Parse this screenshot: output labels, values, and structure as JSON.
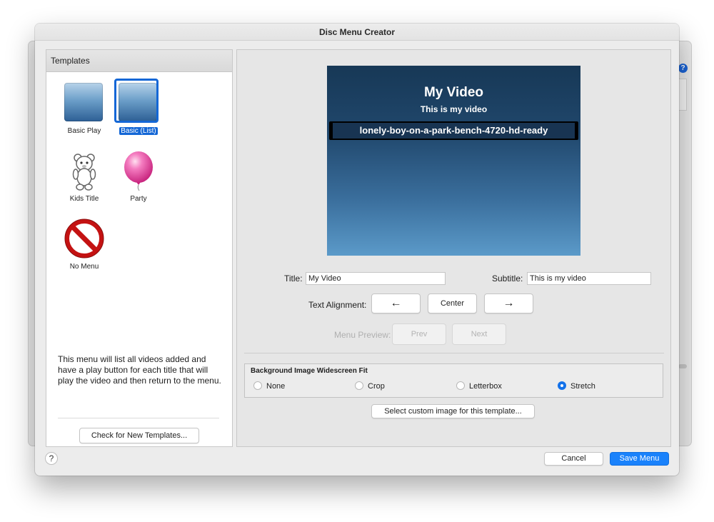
{
  "window": {
    "title": "Disc Menu Creator",
    "help_badge": "?"
  },
  "templates_panel": {
    "header": "Templates",
    "items": [
      {
        "label": "Basic Play",
        "icon": "gradient-square-icon",
        "selected": false
      },
      {
        "label": "Basic (List)",
        "icon": "gradient-square-icon",
        "selected": true
      },
      {
        "label": "Kids Title",
        "icon": "teddy-bear-icon",
        "selected": false
      },
      {
        "label": "Party",
        "icon": "pink-balloon-icon",
        "selected": false
      },
      {
        "label": "No Menu",
        "icon": "prohibited-sign-icon",
        "selected": false
      }
    ],
    "description": "This menu will list all videos added and have a play button for each title that will play the video and then return to the menu.",
    "check_button": "Check for New Templates..."
  },
  "preview": {
    "title": "My Video",
    "subtitle": "This is my video",
    "list_item": "lonely-boy-on-a-park-bench-4720-hd-ready"
  },
  "form": {
    "title_label": "Title:",
    "title_value": "My Video",
    "subtitle_label": "Subtitle:",
    "subtitle_value": "This is my video",
    "alignment_label": "Text Alignment:",
    "align_left": "←",
    "align_center": "Center",
    "align_right": "→",
    "menu_preview_label": "Menu Preview:",
    "prev": "Prev",
    "next": "Next"
  },
  "fit": {
    "title": "Background Image Widescreen Fit",
    "options": [
      "None",
      "Crop",
      "Letterbox",
      "Stretch"
    ],
    "selected": "Stretch",
    "custom_image_button": "Select custom image for this template..."
  },
  "footer": {
    "help": "?",
    "cancel": "Cancel",
    "save": "Save Menu"
  },
  "colors": {
    "accent": "#1a82fb",
    "selection": "#1467d6"
  }
}
